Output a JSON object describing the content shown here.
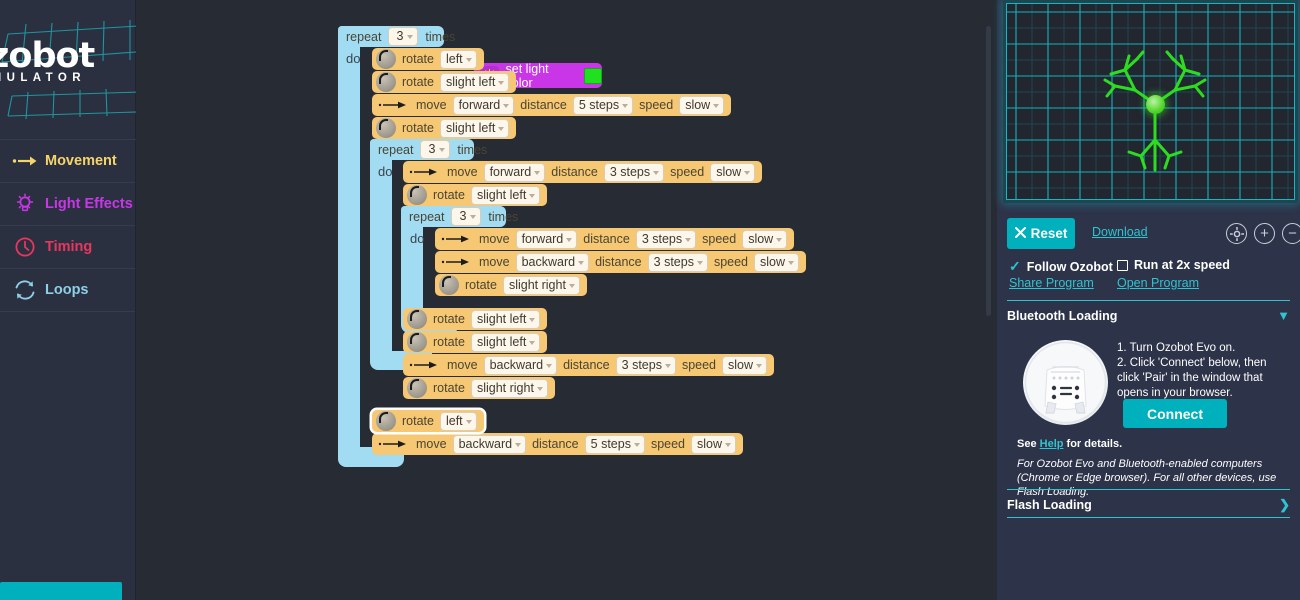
{
  "sidebar": {
    "logo_word": "ozobot",
    "logo_sub": "SIMULATOR",
    "categories": [
      {
        "label": "Movement",
        "icon": "arrow-right-icon",
        "color": "#f5d56a"
      },
      {
        "label": "Light Effects",
        "icon": "lightbulb-icon",
        "color": "#c936e8"
      },
      {
        "label": "Timing",
        "icon": "clock-icon",
        "color": "#e8365f"
      },
      {
        "label": "Loops",
        "icon": "loop-refresh-icon",
        "color": "#8ecfe8"
      }
    ]
  },
  "workspace": {
    "light_block": {
      "label": "set light color",
      "icon": "lightbulb-icon",
      "color": "#20e021"
    },
    "words": {
      "repeat": "repeat",
      "times": "times",
      "do": "do",
      "move": "move",
      "rotate": "rotate",
      "distance": "distance",
      "speed": "speed"
    },
    "blocks": [
      {
        "id": "r1",
        "kind": "repeat",
        "count": "3"
      },
      {
        "id": "b1",
        "kind": "rotate",
        "dir": "left",
        "selected": false
      },
      {
        "id": "b2",
        "kind": "rotate",
        "dir": "slight left",
        "selected": false
      },
      {
        "id": "b3",
        "kind": "move",
        "dir": "forward",
        "distance": "5 steps",
        "speed": "slow"
      },
      {
        "id": "b4",
        "kind": "rotate",
        "dir": "slight left",
        "selected": false
      },
      {
        "id": "r2",
        "kind": "repeat",
        "count": "3"
      },
      {
        "id": "b5",
        "kind": "move",
        "dir": "forward",
        "distance": "3 steps",
        "speed": "slow"
      },
      {
        "id": "b6",
        "kind": "rotate",
        "dir": "slight left",
        "selected": false
      },
      {
        "id": "r3",
        "kind": "repeat",
        "count": "3"
      },
      {
        "id": "b7",
        "kind": "move",
        "dir": "forward",
        "distance": "3 steps",
        "speed": "slow"
      },
      {
        "id": "b8",
        "kind": "move",
        "dir": "backward",
        "distance": "3 steps",
        "speed": "slow"
      },
      {
        "id": "b9",
        "kind": "rotate",
        "dir": "slight right",
        "selected": false
      },
      {
        "id": "b10",
        "kind": "rotate",
        "dir": "slight left",
        "selected": false
      },
      {
        "id": "b11",
        "kind": "rotate",
        "dir": "slight left",
        "selected": false
      },
      {
        "id": "b12",
        "kind": "move",
        "dir": "backward",
        "distance": "3 steps",
        "speed": "slow"
      },
      {
        "id": "b13",
        "kind": "rotate",
        "dir": "slight right",
        "selected": false
      },
      {
        "id": "b14",
        "kind": "rotate",
        "dir": "left",
        "selected": true
      },
      {
        "id": "b15",
        "kind": "move",
        "dir": "backward",
        "distance": "5 steps",
        "speed": "slow"
      }
    ]
  },
  "simulator": {
    "grid_color": "#17b6c4",
    "trail_color": "#2fe01f",
    "robot_label": "ozobot-marker"
  },
  "controls": {
    "reset_label": "Reset",
    "download_label": "Download",
    "center_icon": "crosshair-target-icon",
    "zoom_in_label": "+",
    "zoom_out_label": "−",
    "follow_label": "Follow Ozobot",
    "speed_label": "Run at 2x speed",
    "share_label": "Share Program",
    "open_label": "Open Program"
  },
  "bluetooth": {
    "section_title": "Bluetooth Loading",
    "step1": "1. Turn Ozobot Evo on.",
    "step2": "2. Click 'Connect' below, then click 'Pair' in the window that opens in your browser.",
    "connect_label": "Connect",
    "help_prefix": "See ",
    "help_link": "Help",
    "help_suffix": " for details.",
    "note": "For Ozobot Evo and Bluetooth-enabled computers (Chrome or Edge browser). For all other devices, use Flash Loading."
  },
  "flash": {
    "section_title": "Flash Loading"
  }
}
